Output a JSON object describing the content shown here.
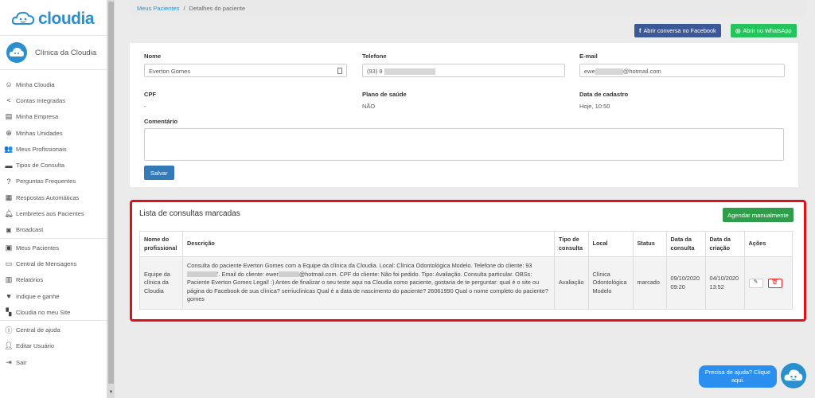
{
  "brand": {
    "name_part1": "cloud",
    "name_part2": "ia"
  },
  "clinic": {
    "name": "Clínica da Cloudia"
  },
  "sidebar": {
    "group1": [
      {
        "label": "Minha Cloudia",
        "icon": "smile-icon"
      },
      {
        "label": "Contas Integradas",
        "icon": "share-icon"
      },
      {
        "label": "Minha Empresa",
        "icon": "store-icon"
      },
      {
        "label": "Minhas Unidades",
        "icon": "plus-circle-icon"
      },
      {
        "label": "Meus Profissionais",
        "icon": "people-icon"
      },
      {
        "label": "Tipos de Consulta",
        "icon": "list-icon"
      },
      {
        "label": "Perguntas Frequentes",
        "icon": "question-icon"
      },
      {
        "label": "Respostas Automáticas",
        "icon": "message-icon"
      },
      {
        "label": "Lembretes aos Pacientes",
        "icon": "bell-icon"
      },
      {
        "label": "Broadcast",
        "icon": "broadcast-icon"
      }
    ],
    "group2": [
      {
        "label": "Meus Pacientes",
        "icon": "patients-icon"
      },
      {
        "label": "Central de Mensagens",
        "icon": "chat-icon"
      },
      {
        "label": "Relatórios",
        "icon": "chart-icon"
      },
      {
        "label": "Indique e ganhe",
        "icon": "heart-icon"
      },
      {
        "label": "Cloudia no meu Site",
        "icon": "widgets-icon"
      }
    ],
    "group3": [
      {
        "label": "Central de ajuda",
        "icon": "help-circle-icon"
      },
      {
        "label": "Editar Usuário",
        "icon": "user-icon"
      },
      {
        "label": "Sair",
        "icon": "exit-icon"
      }
    ]
  },
  "breadcrumb": {
    "link": "Meus Pacientes",
    "separator": "/",
    "current": "Detalhes do paciente"
  },
  "actions": {
    "facebook": "Abrir conversa no Facebook",
    "whatsapp": "Abrir no WhatsApp"
  },
  "form": {
    "name_label": "Nome",
    "name_value": "Everton Gomes",
    "phone_label": "Telefone",
    "phone_value": "(93) 9",
    "email_label": "E-mail",
    "email_prefix": "ewe",
    "email_suffix": "@hotmail.com",
    "cpf_label": "CPF",
    "cpf_value": "-",
    "plan_label": "Plano de saúde",
    "plan_value": "NÃO",
    "created_label": "Data de cadastro",
    "created_value": "Hoje, 10:50",
    "comment_label": "Comentário",
    "save": "Salvar"
  },
  "consultations": {
    "title": "Lista de consultas marcadas",
    "schedule_button": "Agendar manualmente",
    "headers": {
      "professional": "Nome do profissional",
      "description": "Descrição",
      "type": "Tipo de consulta",
      "location": "Local",
      "status": "Status",
      "date": "Data da consulta",
      "created": "Data da criação",
      "actions": "Ações"
    },
    "row": {
      "professional": "Equipe da clínica da Cloudia",
      "desc_part1": "Consulta do paciente Everton Gomes com a Equipe da clínica da Cloudia. Local: Clínica Odontológica Modelo. Telefone do cliente:",
      "desc_part2": "93",
      "desc_part3": "'. Email do cliente: ewer",
      "desc_part4": "@hotmail.com. CPF do cliente: Não foi pedido. Tipo: Avaliação. Consulta particular. OBSs: Paciente Everton Gomes Legal! :) Antes de finalizar o seu teste aqui na Cloudia como paciente, gostaria de te perguntar: qual é o site ou página do Facebook de sua clínica? serriuclinicas Qual é a data de nascimento do paciente? 26061990 Qual o nome completo do paciente? gomes",
      "type": "Avaliação",
      "location": "Clínica Odontológica Modelo",
      "status": "marcado",
      "date": "09/10/2020 09:20",
      "created": "04/10/2020 13:52"
    }
  },
  "help": {
    "text": "Precisa de ajuda? Clique aqui."
  },
  "colors": {
    "primary": "#2a8fcf",
    "facebook": "#3b5998",
    "whatsapp": "#25c35b",
    "success": "#2e9e4a",
    "danger": "#e0101a"
  }
}
